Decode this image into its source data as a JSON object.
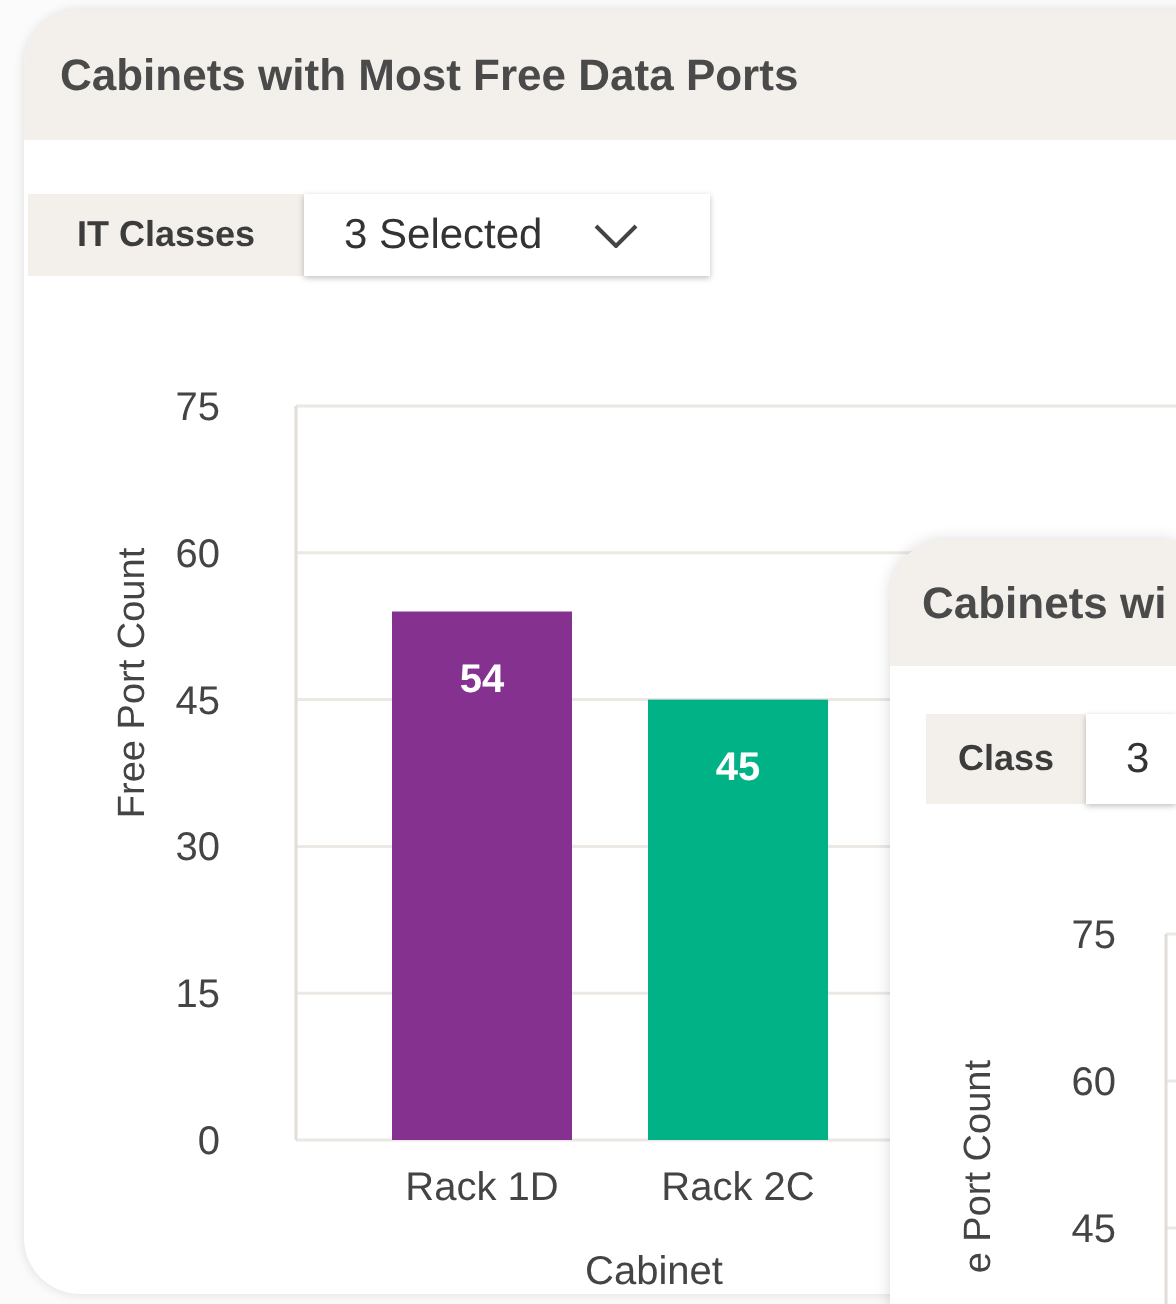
{
  "cards": [
    {
      "title": "Cabinets with Most Free Data Ports",
      "filter": {
        "label": "IT Classes",
        "value": "3 Selected",
        "has_chevron": true
      },
      "chart_data": {
        "type": "bar",
        "xlabel": "Cabinet",
        "ylabel": "Free Port Count",
        "categories": [
          "Rack 1D",
          "Rack 2C"
        ],
        "colors": [
          "#84318f",
          "#00b286"
        ],
        "values": [
          54,
          45
        ],
        "ylim": [
          0,
          75
        ],
        "yticks": [
          0,
          15,
          30,
          45,
          60,
          75
        ],
        "grid": true,
        "data_labels": true
      }
    },
    {
      "title": "Cabinets wi",
      "filter": {
        "label": "Class",
        "value": "3"
      },
      "y_axis": {
        "title": "e Port Count",
        "ticks": [
          "75",
          "60",
          "45"
        ]
      }
    }
  ]
}
